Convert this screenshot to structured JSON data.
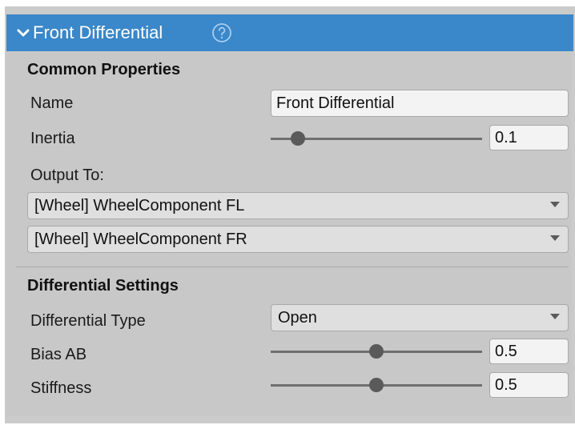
{
  "header": {
    "title": "Front Differential",
    "icons": {
      "expand": "chevron-down-icon",
      "help": "help-icon"
    },
    "color": "#3a87c9"
  },
  "common": {
    "title": "Common Properties",
    "name_label": "Name",
    "name_value": "Front Differential",
    "inertia_label": "Inertia",
    "inertia_value": "0.1",
    "inertia_slider_fraction": 0.13,
    "output_label": "Output To:",
    "outputs": [
      "[Wheel] WheelComponent FL",
      "[Wheel] WheelComponent FR"
    ]
  },
  "differential": {
    "title": "Differential Settings",
    "type_label": "Differential Type",
    "type_value": "Open",
    "bias_label": "Bias AB",
    "bias_value": "0.5",
    "bias_slider_fraction": 0.5,
    "stiffness_label": "Stiffness",
    "stiffness_value": "0.5",
    "stiffness_slider_fraction": 0.5
  }
}
